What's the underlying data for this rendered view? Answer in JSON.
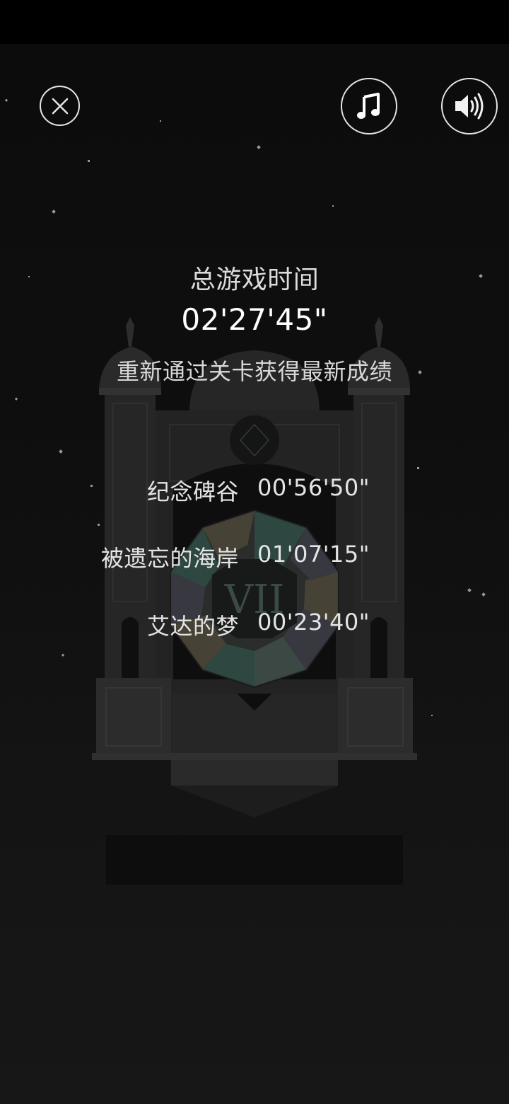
{
  "buttons": {
    "close_icon": "close-icon",
    "music_icon": "music-note-icon",
    "sound_icon": "speaker-icon"
  },
  "stats": {
    "total_label": "总游戏时间",
    "total_time": "02'27'45\"",
    "hint": "重新通过关卡获得最新成绩"
  },
  "levels": [
    {
      "name": "纪念碑谷",
      "time": "00'56'50\""
    },
    {
      "name": "被遗忘的海岸",
      "time": "01'07'15\""
    },
    {
      "name": "艾达的梦",
      "time": "00'23'40\""
    }
  ],
  "monument": {
    "numeral": "VII"
  },
  "colors": {
    "background": "#0f0f0f",
    "text": "#e4e4e4",
    "icon": "#e6e6e6",
    "monument": "#2a2a2a"
  }
}
